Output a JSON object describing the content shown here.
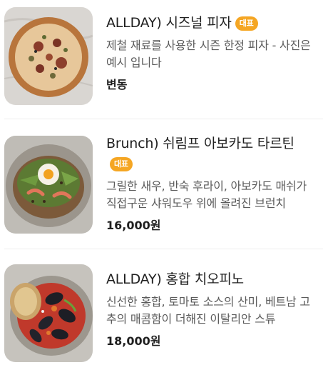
{
  "menu": {
    "items": [
      {
        "name": "ALLDAY) 시즈널 피자",
        "badge": "대표",
        "description": "제철 재료를 사용한 시즌 한정 피자 - 사진은 예시 입니다",
        "price": "변동",
        "image_icon": "pizza-photo"
      },
      {
        "name": "Brunch) 쉬림프 아보카도 타르틴",
        "badge": "대표",
        "description": "그릴한 새우, 반숙 후라이, 아보카도 매쉬가 직접구운 샤워도우 위에 올려진 브런치",
        "price": "16,000원",
        "image_icon": "tartine-photo"
      },
      {
        "name": "ALLDAY) 홍합 치오피노",
        "badge": "",
        "description": "신선한 홍합, 토마토 소스의 산미, 베트남 고추의 매콤함이 더해진 이탈리안 스튜",
        "price": "18,000원",
        "image_icon": "cioppino-photo"
      }
    ]
  },
  "colors": {
    "badge": "#f5a623",
    "text": "#1f1f1f",
    "description": "#5b5b5b",
    "divider": "#efefef"
  }
}
